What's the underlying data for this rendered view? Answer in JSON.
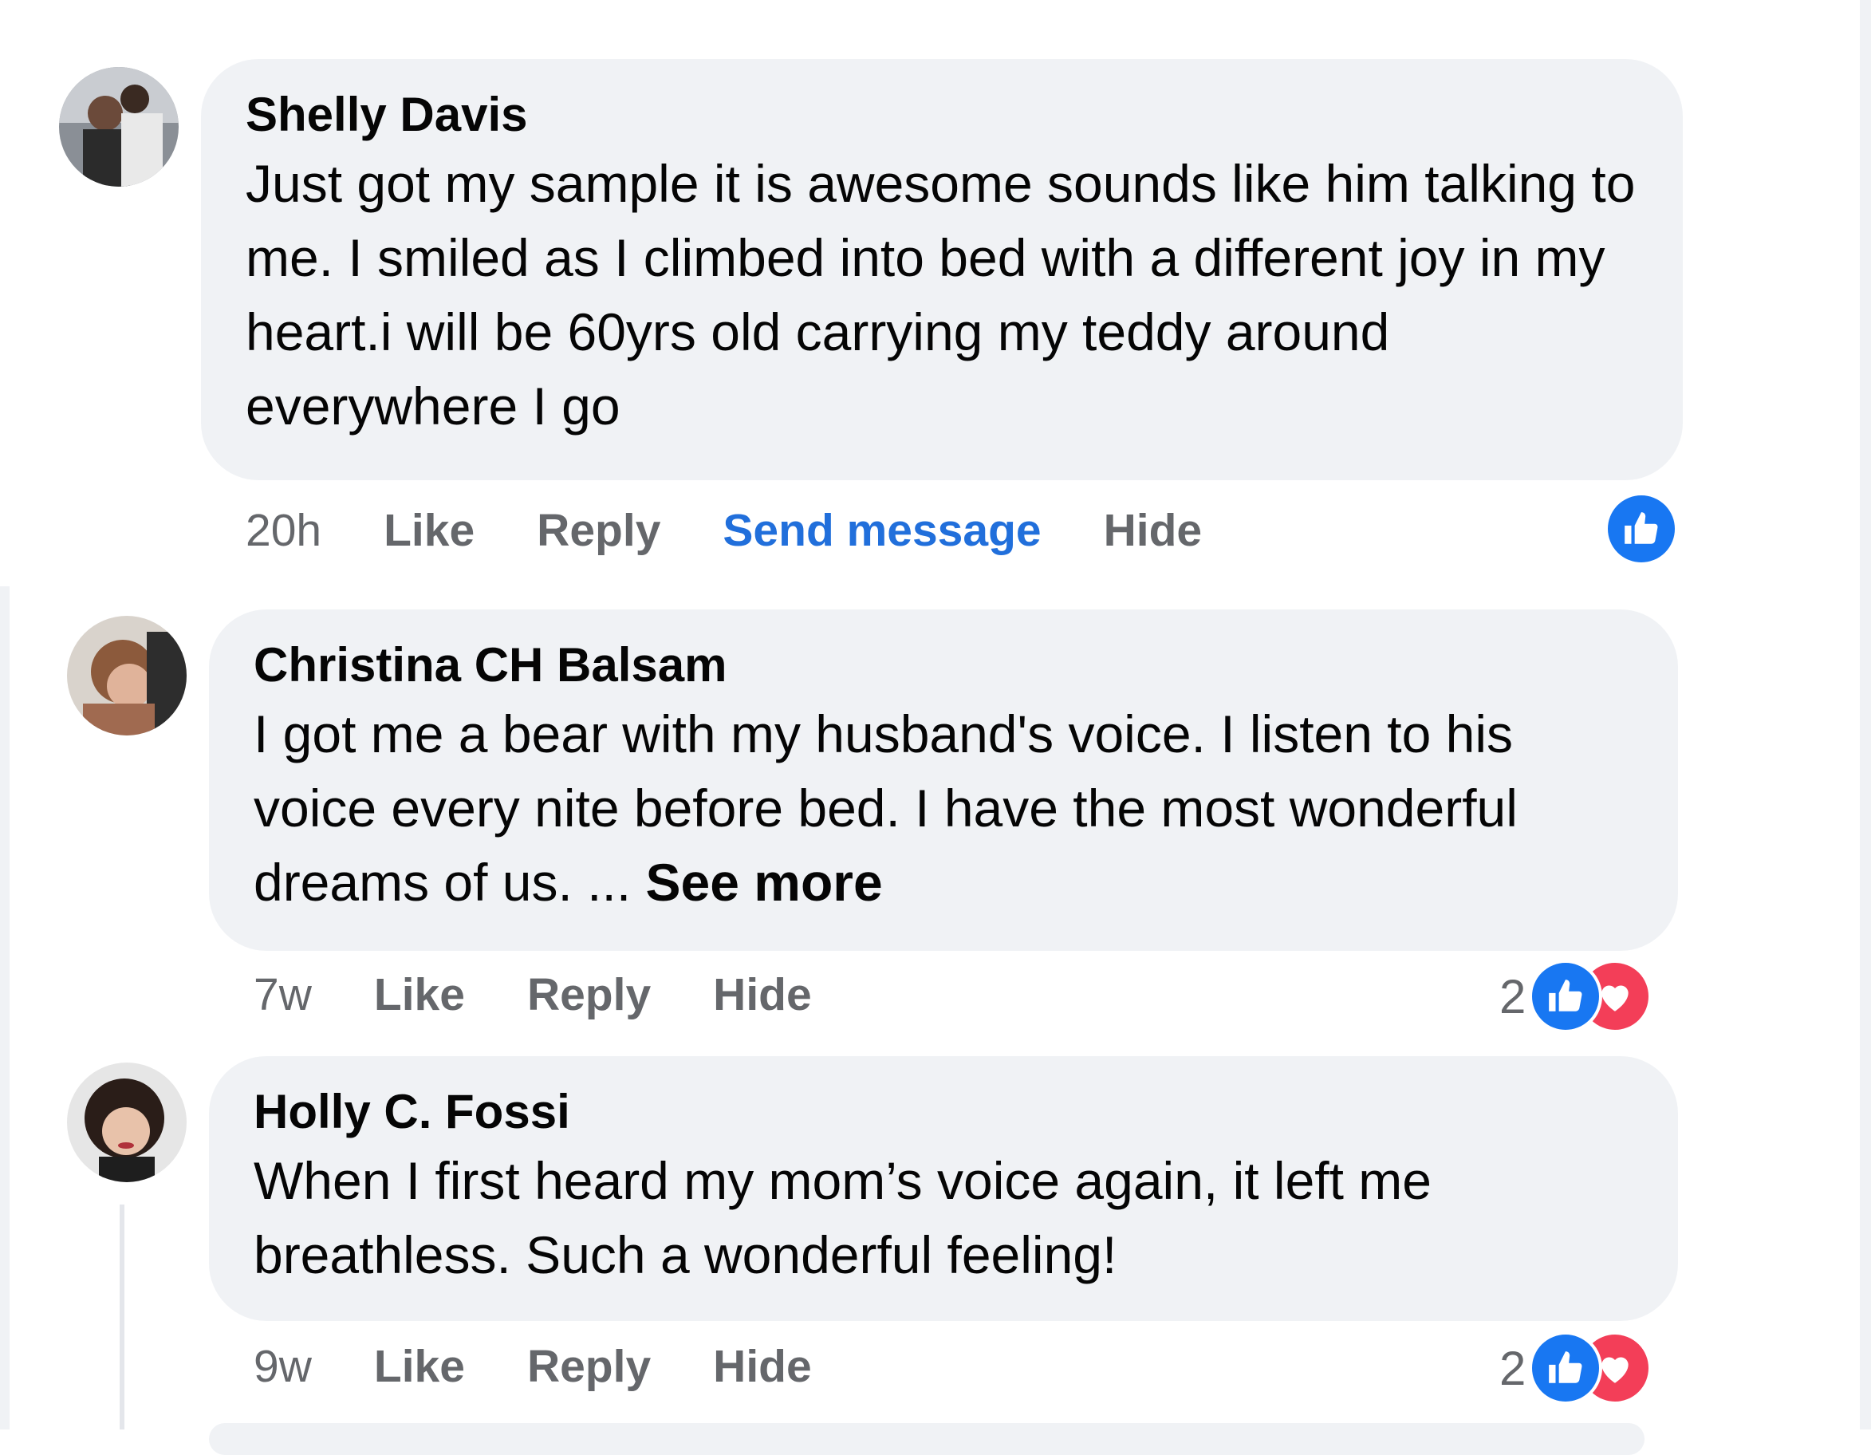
{
  "comments": [
    {
      "author": "Shelly Davis",
      "text": "Just got my sample it is awesome sounds like him talking to me. I smiled as I climbed into bed with a different joy in my heart.i will be 60yrs old carrying my teddy around everywhere I go",
      "time": "20h",
      "actions": [
        "Like",
        "Reply",
        "Send message",
        "Hide"
      ],
      "reaction_count": "",
      "reactions": [
        "like-icon"
      ]
    },
    {
      "author": "Christina CH Balsam",
      "text": "I got me a bear with my husband's voice. I listen to his voice every nite before bed. I have the most wonderful dreams of us. ... ",
      "see_more": "See more",
      "time": "7w",
      "actions": [
        "Like",
        "Reply",
        "Hide"
      ],
      "reaction_count": "2",
      "reactions": [
        "like-icon",
        "heart-icon"
      ]
    },
    {
      "author": "Holly C. Fossi",
      "text": "When I first heard my mom’s voice again, it left me breathless. Such a wonderful feeling!",
      "time": "9w",
      "actions": [
        "Like",
        "Reply",
        "Hide"
      ],
      "reaction_count": "2",
      "reactions": [
        "like-icon",
        "heart-icon"
      ]
    }
  ],
  "colors": {
    "bubble": "#f0f2f5",
    "link_blue": "#216fdb",
    "meta_gray": "#65676b",
    "like_blue": "#1877f2",
    "heart_red": "#f33e58"
  }
}
